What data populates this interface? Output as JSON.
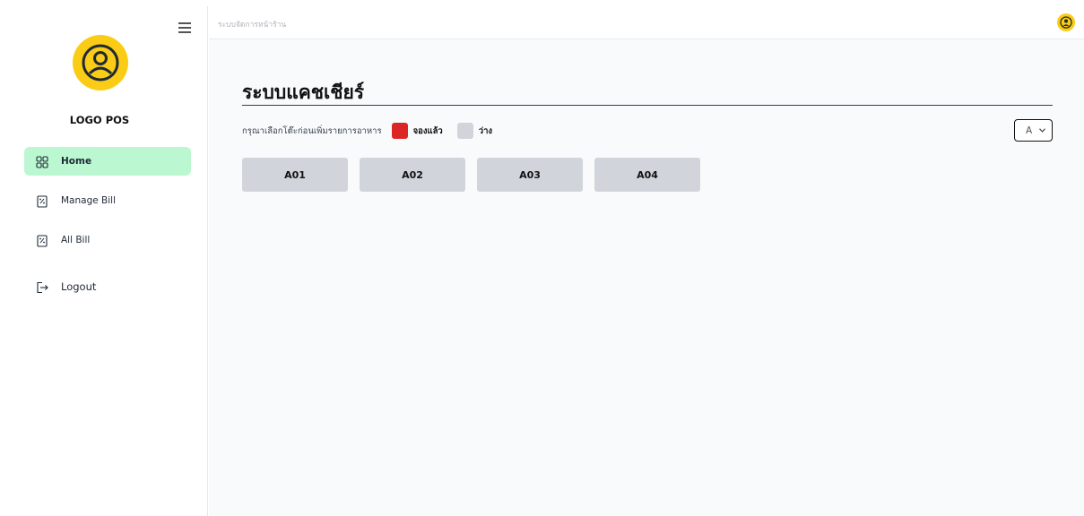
{
  "app": {
    "logo_text": "LOGO POS",
    "breadcrumb": "ระบบจัดการหน้าร้าน"
  },
  "sidebar": {
    "items": [
      {
        "label": "Home",
        "icon": "grid-icon",
        "active": true
      },
      {
        "label": "Manage Bill",
        "icon": "receipt-icon",
        "active": false
      },
      {
        "label": "All Bill",
        "icon": "receipt-icon",
        "active": false
      },
      {
        "label": "Logout",
        "icon": "logout-icon",
        "active": false
      }
    ]
  },
  "main": {
    "title": "ระบบแคชเชียร์",
    "instruction": "กรุณาเลือกโต๊ะก่อนเพิ่มรายการอาหาร",
    "legend": {
      "booked_label": "จองแล้ว",
      "free_label": "ว่าง"
    },
    "zone_select": {
      "value": "A"
    },
    "tables": [
      {
        "label": "A01",
        "status": "free"
      },
      {
        "label": "A02",
        "status": "free"
      },
      {
        "label": "A03",
        "status": "free"
      },
      {
        "label": "A04",
        "status": "free"
      }
    ]
  },
  "colors": {
    "accent_yellow": "#facc15",
    "active_nav_bg": "#bbf7d0",
    "booked": "#dc2626",
    "free": "#d1d5db"
  }
}
